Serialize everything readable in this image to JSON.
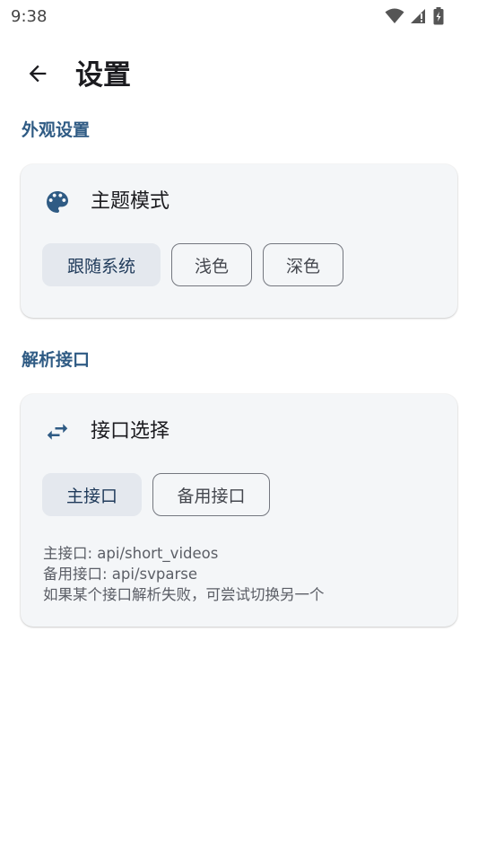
{
  "status_bar": {
    "time": "9:38",
    "icons": [
      "wifi-icon",
      "signal-icon",
      "battery-icon"
    ]
  },
  "header": {
    "title": "设置",
    "back_icon": "arrow-left-icon"
  },
  "sections": [
    {
      "title": "外观设置",
      "card": {
        "icon": "palette-icon",
        "title": "主题模式",
        "options": [
          "跟随系统",
          "浅色",
          "深色"
        ],
        "selected": "跟随系统"
      }
    },
    {
      "title": "解析接口",
      "card": {
        "icon": "swap-arrows-icon",
        "title": "接口选择",
        "options": [
          "主接口",
          "备用接口"
        ],
        "selected": "主接口",
        "info": [
          "主接口: api/short_videos",
          "备用接口: api/svparse",
          "如果某个接口解析失败，可尝试切换另一个"
        ]
      }
    }
  ],
  "colors": {
    "accent": "#2f5b84",
    "card_bg": "#f4f6f8",
    "chip_selected_bg": "#e4e8ee"
  }
}
